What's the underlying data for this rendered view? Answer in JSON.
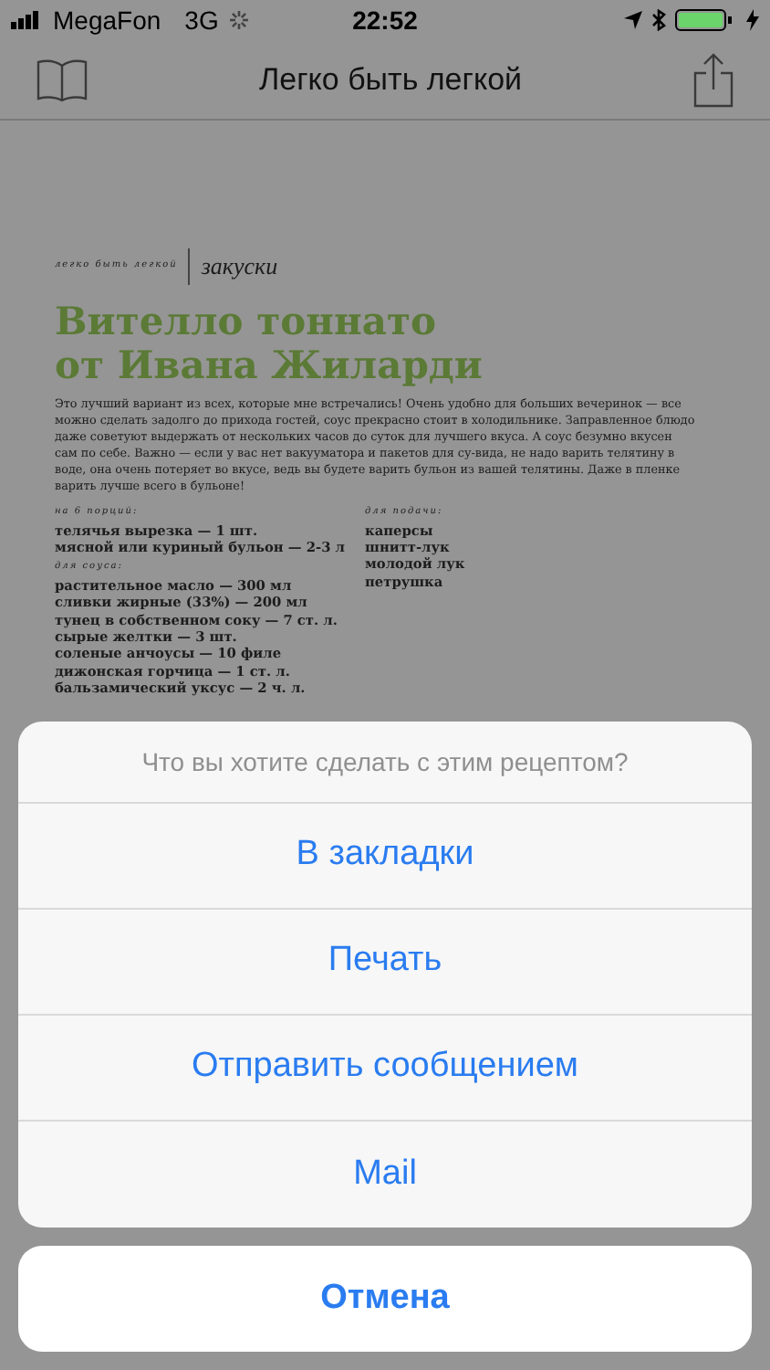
{
  "status_bar": {
    "carrier": "MegaFon",
    "network": "3G",
    "time": "22:52"
  },
  "nav": {
    "title": "Легко быть легкой"
  },
  "article": {
    "brand": "легко быть легкой",
    "category": "закуски",
    "title_lines": [
      "Вителло тоннато",
      "от Ивана Жиларди"
    ],
    "intro": "Это лучший вариант из всех, которые мне встречались! Очень удобно для больших вечеринок — все можно сделать задолго до прихода гостей, соус прекрасно стоит в холодильнике. Заправленное блюдо даже советуют выдержать от нескольких часов до суток для лучшего вкуса. А соус безумно вкусен сам по себе. Важно — если у вас нет вакууматора и пакетов для су-вида, не надо варить телятину в воде, она очень потеряет во вкусе, ведь вы будете варить бульон из вашей телятины. Даже в пленке варить лучше всего в бульоне!",
    "columns": [
      {
        "groups": [
          {
            "label": "на 6 порций:",
            "items": [
              "телячья вырезка — 1 шт.",
              "мясной или куриный бульон — 2-3 л"
            ]
          },
          {
            "label": "для соуса:",
            "items": [
              "растительное масло — 300 мл",
              "сливки жирные (33%) — 200 мл",
              "тунец в собственном соку — 7 ст. л.",
              "сырые желтки — 3 шт.",
              "соленые анчоусы — 10 филе",
              "дижонская горчица — 1 ст. л.",
              "бальзамический уксус — 2 ч. л."
            ]
          }
        ]
      },
      {
        "groups": [
          {
            "label": "для подачи:",
            "items": [
              "каперсы",
              "шнитт-лук",
              "молодой лук",
              "петрушка"
            ]
          }
        ]
      }
    ]
  },
  "action_sheet": {
    "title": "Что вы хотите сделать с этим рецептом?",
    "actions": [
      "В закладки",
      "Печать",
      "Отправить сообщением",
      "Mail"
    ],
    "cancel": "Отмена"
  }
}
